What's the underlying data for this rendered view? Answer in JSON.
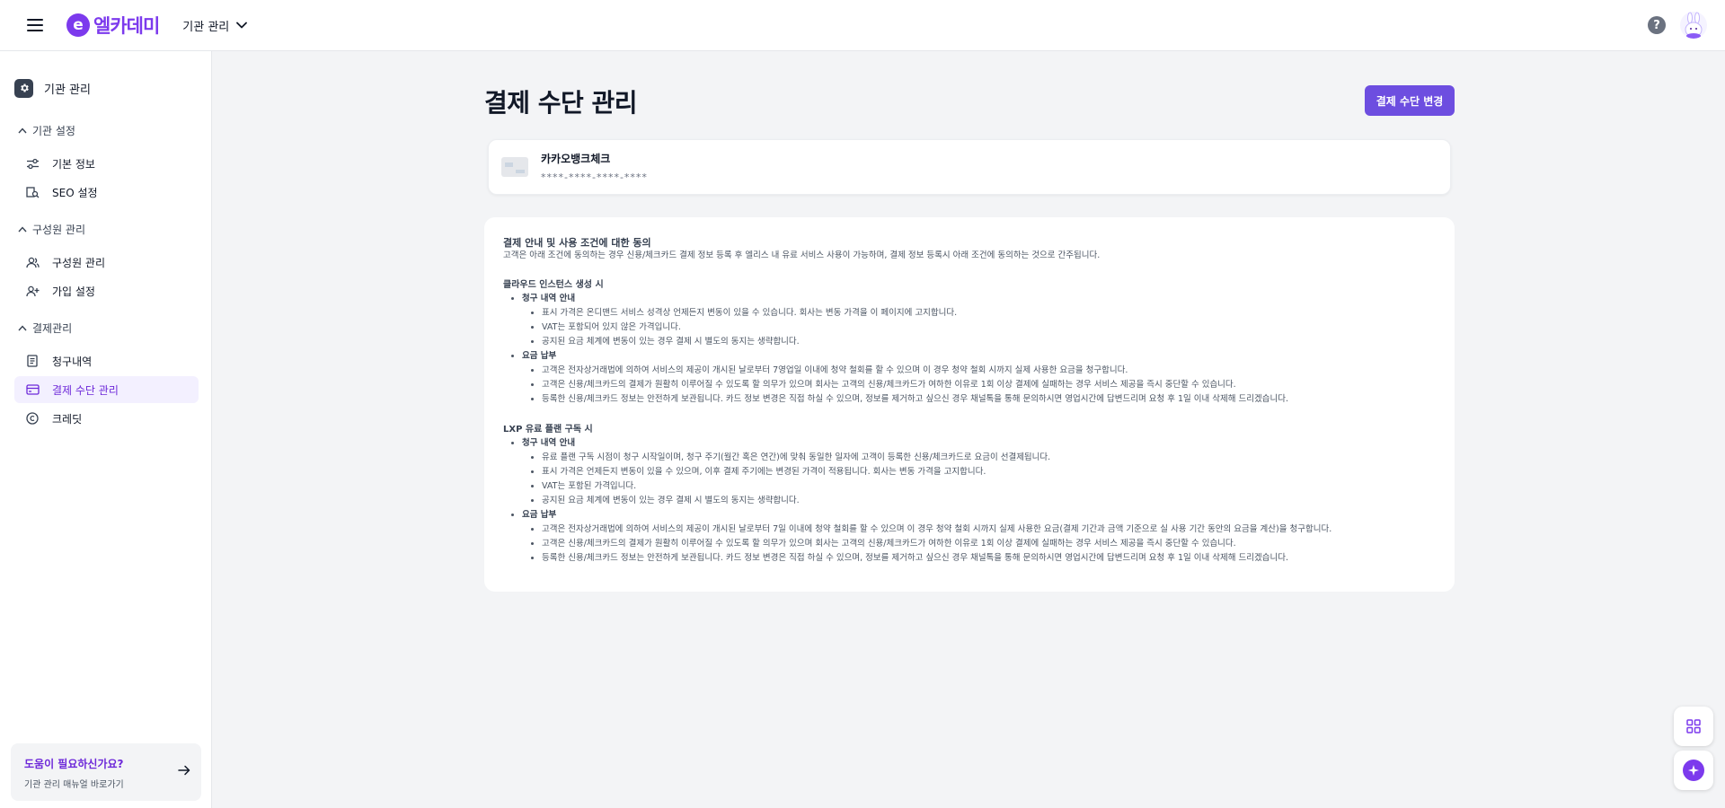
{
  "header": {
    "logo_mark": "e",
    "logo_text": "엘카데미",
    "org_selector": "기관 관리"
  },
  "sidebar": {
    "title": "기관 관리",
    "sections": [
      {
        "title": "기관 설정",
        "items": [
          {
            "label": "기본 정보",
            "icon": "sliders-icon"
          },
          {
            "label": "SEO 설정",
            "icon": "seo-icon"
          }
        ]
      },
      {
        "title": "구성원 관리",
        "items": [
          {
            "label": "구성원 관리",
            "icon": "users-icon"
          },
          {
            "label": "가입 설정",
            "icon": "user-plus-icon"
          }
        ]
      },
      {
        "title": "결제관리",
        "items": [
          {
            "label": "청구내역",
            "icon": "receipt-icon"
          },
          {
            "label": "결제 수단 관리",
            "icon": "credit-card-icon",
            "active": true
          },
          {
            "label": "크레딧",
            "icon": "copyright-icon"
          }
        ]
      }
    ],
    "help": {
      "title": "도움이 필요하신가요?",
      "subtitle": "기관 관리 매뉴얼 바로가기"
    }
  },
  "main": {
    "title": "결제 수단 관리",
    "change_button": "결제 수단 변경",
    "card": {
      "name": "카카오뱅크체크",
      "number": "****-****-****-****"
    },
    "terms": {
      "title": "결제 안내 및 사용 조건에 대한 동의",
      "intro": "고객은 아래 조건에 동의하는 경우 신용/체크카드 결제 정보 등록 후 엘리스 내 유료 서비스 사용이 가능하며, 결제 정보 등록시 아래 조건에 동의하는 것으로 간주됩니다.",
      "sections": [
        {
          "title": "클라우드 인스턴스 생성 시",
          "groups": [
            {
              "title": "청구 내역 안내",
              "items": [
                "표시 가격은 온디맨드 서비스 성격상 언제든지 변동이 있을 수 있습니다. 회사는 변동 가격을 이 페이지에 고지합니다.",
                "VAT는 포함되어 있지 않은 가격입니다.",
                "공지된 요금 체계에 변동이 있는 경우 결제 시 별도의 동지는 생략합니다."
              ]
            },
            {
              "title": "요금 납부",
              "items": [
                "고객은 전자상거래법에 의하여 서비스의 제공이 개시된 날로부터 7영업일 이내에 청약 철회를 할 수 있으며 이 경우 청약 철회 시까지 실제 사용한 요금을 청구합니다.",
                "고객은 신용/체크카드의 결제가 원활히 이루어질 수 있도록 할 의무가 있으며 회사는 고객의 신용/체크카드가 여하한 이유로 1회 이상 결제에 실패하는 경우 서비스 제공을 즉시 중단할 수 있습니다.",
                "등록한 신용/체크카드 정보는 안전하게 보관됩니다. 카드 정보 변경은 직접 하실 수 있으며, 정보를 제거하고 싶으신 경우 채널톡을 통해 문의하시면 영업시간에 답변드리며 요청 후 1일 이내 삭제해 드리겠습니다."
              ]
            }
          ]
        },
        {
          "title": "LXP 유료 플랜 구독 시",
          "groups": [
            {
              "title": "청구 내역 안내",
              "items": [
                "유료 플랜 구독 시점이 청구 시작일이며, 청구 주기(월간 혹은 연간)에 맞춰 동일한 일자에 고객이 등록한 신용/체크카드로 요금이 선결제됩니다.",
                "표시 가격은 언제든지 변동이 있을 수 있으며, 이후 결제 주기에는 변경된 가격이 적용됩니다. 회사는 변동 가격을 고지합니다.",
                "VAT는 포함된 가격입니다.",
                "공지된 요금 체계에 변동이 있는 경우 결제 시 별도의 동지는 생략합니다."
              ]
            },
            {
              "title": "요금 납부",
              "items": [
                "고객은 전자상거래법에 의하여 서비스의 제공이 개시된 날로부터 7일 이내에 청약 철회를 할 수 있으며 이 경우 청약 철회 시까지 실제 사용한 요금(결제 기간과 금액 기준으로 실 사용 기간 동안의 요금을 계산)을 청구합니다.",
                "고객은 신용/체크카드의 결제가 원활히 이루어질 수 있도록 할 의무가 있으며 회사는 고객의 신용/체크카드가 여하한 이유로 1회 이상 결제에 실패하는 경우 서비스 제공을 즉시 중단할 수 있습니다.",
                "등록한 신용/체크카드 정보는 안전하게 보관됩니다. 카드 정보 변경은 직접 하실 수 있으며, 정보를 제거하고 싶으신 경우 채널톡을 통해 문의하시면 영업시간에 답변드리며 요청 후 1일 이내 삭제해 드리겠습니다."
              ]
            }
          ]
        }
      ]
    }
  },
  "colors": {
    "brand": "#7c3aed",
    "primary_button": "#6d4ee0",
    "active_nav_bg": "#f3f0ff",
    "page_bg": "#f3f4f6"
  },
  "floating": {
    "apps_icon": "grid-icon",
    "assistant_icon": "star-icon"
  }
}
